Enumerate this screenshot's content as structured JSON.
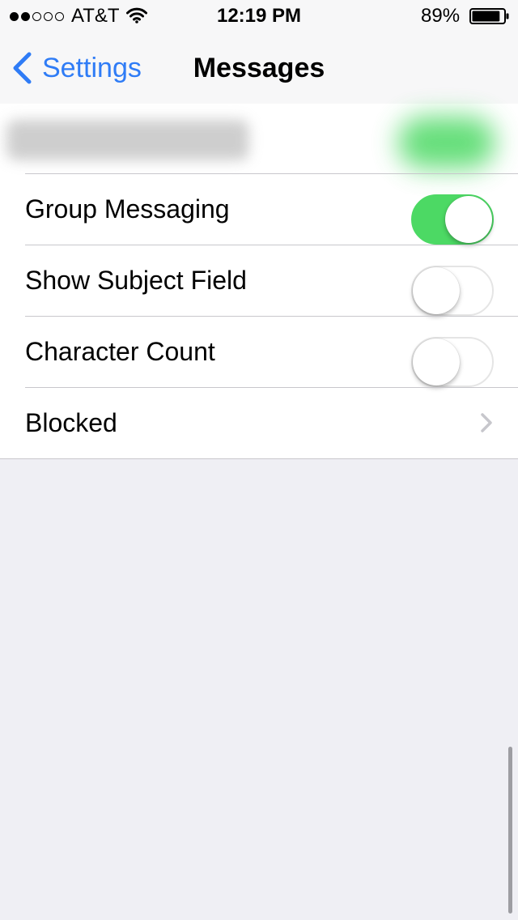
{
  "status_bar": {
    "signal_dots": [
      true,
      true,
      false,
      false,
      false
    ],
    "carrier": "AT&T",
    "wifi_icon": "wifi-icon",
    "time": "12:19 PM",
    "battery_percent": "89%",
    "battery_level": 0.89,
    "battery_icon": "battery-icon"
  },
  "nav": {
    "back_label": "Settings",
    "back_icon": "chevron-left-icon",
    "title": "Messages"
  },
  "settings": {
    "rows": [
      {
        "label": "Group Messaging",
        "type": "toggle",
        "on": true
      },
      {
        "label": "Show Subject Field",
        "type": "toggle",
        "on": false
      },
      {
        "label": "Character Count",
        "type": "toggle",
        "on": false
      },
      {
        "label": "Blocked",
        "type": "disclosure",
        "icon": "chevron-right-icon"
      }
    ]
  },
  "colors": {
    "accent": "#2f7cf6",
    "toggle_on": "#4cd964",
    "separator": "#c8c7cc",
    "background": "#efeff4"
  }
}
